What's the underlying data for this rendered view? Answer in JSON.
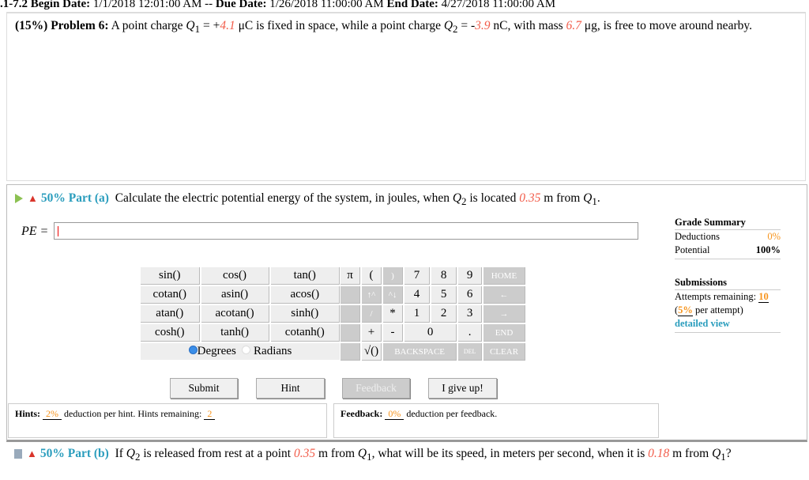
{
  "header": {
    "assignment": ".1-7.2",
    "begin_label": "Begin Date:",
    "begin": "1/1/2018 12:01:00 AM",
    "sep": "--",
    "due_label": "Due Date:",
    "due": "1/26/2018 11:00:00 AM",
    "end_label": "End Date:",
    "end": "4/27/2018 11:00:00 AM"
  },
  "problem": {
    "weight": "(15%)",
    "title": "Problem 6:",
    "t1": "A point charge",
    "q1": "Q",
    "q1sub": "1",
    "t2": "= +",
    "q1val": "4.1",
    "t3": "μC is fixed in space, while a point charge",
    "q2": "Q",
    "q2sub": "2",
    "t4": "= -",
    "q2val": "3.9",
    "t5": "nC, with mass",
    "mass": "6.7",
    "t6": "μg, is free to move around nearby."
  },
  "part_a": {
    "pct": "50%",
    "label": "Part (a)",
    "t1": "Calculate the electric potential energy of the system, in joules, when",
    "q": "Q",
    "qsub": "2",
    "t2": "is located",
    "dist": "0.35",
    "t3": "m from",
    "q1": "Q",
    "q1sub": "1",
    "t4": ".",
    "input_label": "PE =",
    "input_value": ""
  },
  "keypad": {
    "functions": [
      [
        "sin()",
        "cos()",
        "tan()"
      ],
      [
        "cotan()",
        "asin()",
        "acos()"
      ],
      [
        "atan()",
        "acotan()",
        "sinh()"
      ],
      [
        "cosh()",
        "tanh()",
        "cotanh()"
      ]
    ],
    "degrees": "Degrees",
    "radians": "Radians",
    "mode": "Degrees",
    "pi": "π",
    "lparen": "(",
    "rparen": ")",
    "up": "↑^",
    "down": "^↓",
    "slash": "/",
    "star": "*",
    "plus": "+",
    "minus": "-",
    "sqrt": "√()",
    "digits": [
      "7",
      "8",
      "9",
      "4",
      "5",
      "6",
      "1",
      "2",
      "3",
      "0",
      "."
    ],
    "home": "HOME",
    "left": "←",
    "right": "→",
    "end": "END",
    "backspace": "BACKSPACE",
    "del": "DEL",
    "clear": "CLEAR"
  },
  "buttons": {
    "submit": "Submit",
    "hint": "Hint",
    "feedback": "Feedback",
    "giveup": "I give up!"
  },
  "hints": {
    "label": "Hints:",
    "pct": "2%",
    "t1": "deduction per hint. Hints remaining:",
    "remaining": "2"
  },
  "feedback": {
    "label": "Feedback:",
    "pct": "0%",
    "t1": "deduction per feedback."
  },
  "grade": {
    "title": "Grade Summary",
    "deductions_label": "Deductions",
    "deductions": "0%",
    "potential_label": "Potential",
    "potential": "100%",
    "submissions_title": "Submissions",
    "attempts_label": "Attempts remaining:",
    "attempts": "10",
    "per_open": "(",
    "per_pct": "5%",
    "per_text": "per attempt)",
    "detailed": "detailed view"
  },
  "part_b": {
    "pct": "50%",
    "label": "Part (b)",
    "t1": "If",
    "q": "Q",
    "qsub": "2",
    "t2": "is released from rest at a point",
    "d1": "0.35",
    "t3": "m from",
    "q1": "Q",
    "q1sub": "1",
    "t4": ", what will be its speed, in meters per second, when it is",
    "d2": "0.18",
    "t5": "m from",
    "t6": "?"
  },
  "colors": {
    "accent": "#2a9dbd",
    "orange": "#f7941d",
    "red": "#f25c4a"
  }
}
